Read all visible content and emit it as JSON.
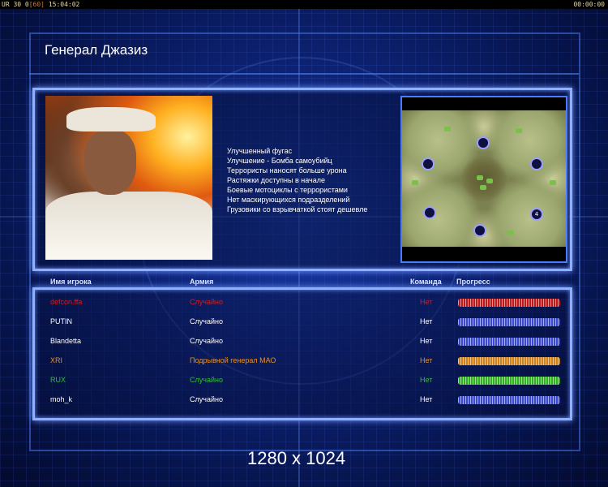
{
  "topbar": {
    "left_a": "UR 30 0",
    "left_b": "[60]",
    "left_c": "15:04:02",
    "right": "00:00:00"
  },
  "header": {
    "title": "Генерал Джазиз"
  },
  "general": {
    "portrait_alt": "Генерал Джазиз",
    "traits": [
      "Улучшенный фугас",
      "Улучшение - Бомба самоубийц",
      "Террористы наносят больше урона",
      "Растяжки доступны в начале",
      "Боевые мотоциклы с террористами",
      "Нет маскирующихся подразделений",
      "Грузовики со взрывчаткой стоят дешевле"
    ]
  },
  "minimap": {
    "start_label": "4"
  },
  "table": {
    "col_player": "Имя игрока",
    "col_army": "Армия",
    "col_team": "Команда",
    "col_progress": "Прогресс",
    "rows": [
      {
        "name": "defcon.ffa",
        "army": "Случайно",
        "team": "Нет",
        "color": "#d02020",
        "bar_color": "#c01818",
        "progress": 1.0
      },
      {
        "name": "PUTIN",
        "army": "Случайно",
        "team": "Нет",
        "color": "#ffffff",
        "bar_color": "#3a4ad0",
        "progress": 1.0
      },
      {
        "name": "Blandetta",
        "army": "Случайно",
        "team": "Нет",
        "color": "#ffffff",
        "bar_color": "#3a4ad0",
        "progress": 1.0
      },
      {
        "name": "XRI",
        "army": "Подрывной генерал МАО",
        "team": "Нет",
        "color": "#e89020",
        "bar_color": "#d08018",
        "progress": 1.0
      },
      {
        "name": "RUX",
        "army": "Случайно",
        "team": "Нет",
        "color": "#30c030",
        "bar_color": "#30b020",
        "progress": 1.0
      },
      {
        "name": "moh_k",
        "army": "Случайно",
        "team": "Нет",
        "color": "#ffffff",
        "bar_color": "#3a4ad0",
        "progress": 1.0
      }
    ]
  },
  "footer": {
    "resolution": "1280 x 1024"
  },
  "colors": {
    "accent_border": "#8fb0ff",
    "background": "#0d2273"
  }
}
